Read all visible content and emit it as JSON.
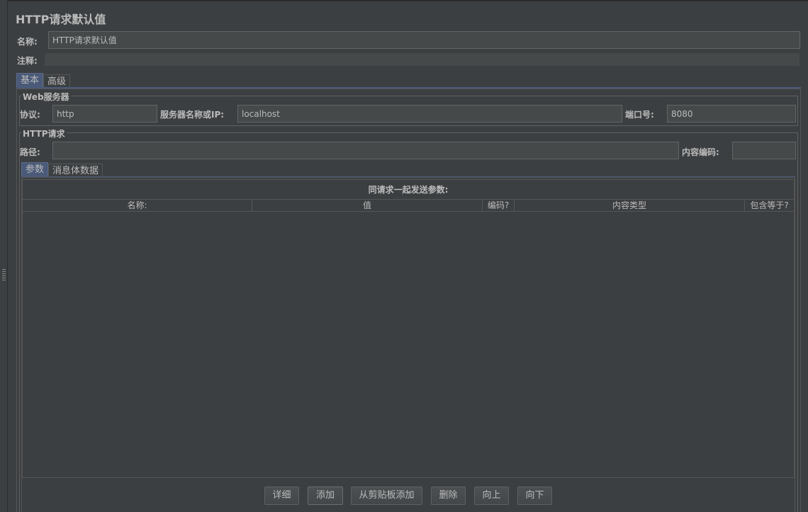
{
  "title": "HTTP请求默认值",
  "name_label": "名称:",
  "name_value": "HTTP请求默认值",
  "comment_label": "注释:",
  "comment_value": "",
  "tabs": [
    {
      "label": "基本",
      "active": true
    },
    {
      "label": "高级",
      "active": false
    }
  ],
  "web_server": {
    "title": "Web服务器",
    "protocol_label": "协议:",
    "protocol_value": "http",
    "server_label": "服务器名称或IP:",
    "server_value": "localhost",
    "port_label": "端口号:",
    "port_value": "8080"
  },
  "http_request": {
    "title": "HTTP请求",
    "path_label": "路径:",
    "path_value": "",
    "encoding_label": "内容编码:",
    "encoding_value": ""
  },
  "sub_tabs": [
    {
      "label": "参数",
      "active": true
    },
    {
      "label": "消息体数据",
      "active": false
    }
  ],
  "params_table": {
    "caption": "同请求一起发送参数:",
    "columns": [
      "名称:",
      "值",
      "编码?",
      "内容类型",
      "包含等于?"
    ],
    "rows": []
  },
  "buttons": {
    "detail": "详细",
    "add": "添加",
    "add_from_clipboard": "从剪贴板添加",
    "delete": "删除",
    "up": "向上",
    "down": "向下"
  },
  "colors": {
    "background": "#3c3f41",
    "field": "#45494a",
    "text": "#bbbbbb",
    "active_tab": "#4a5a78"
  }
}
